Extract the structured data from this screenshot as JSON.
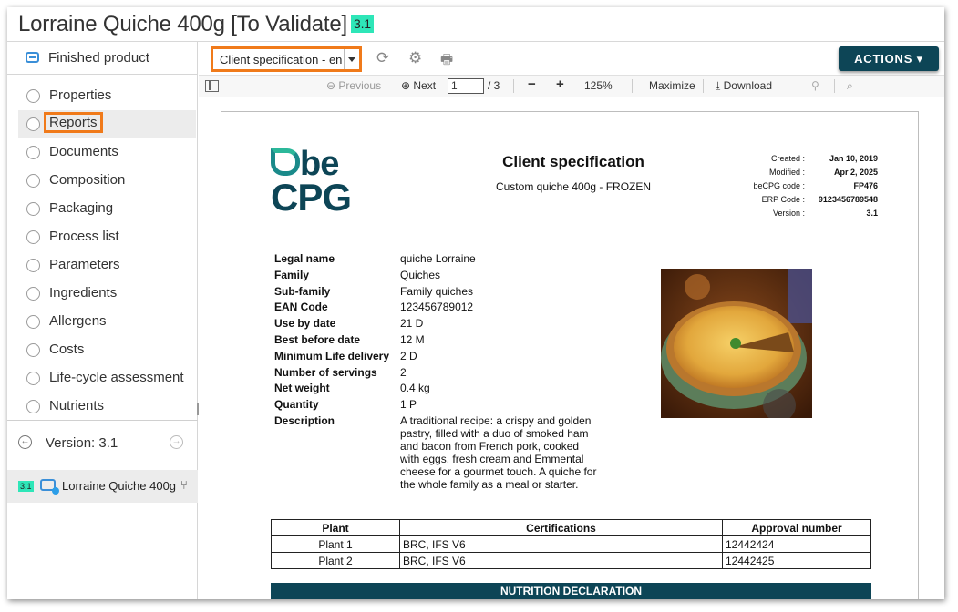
{
  "window": {
    "title": "Lorraine Quiche 400g [To Validate]",
    "version_badge": "3.1"
  },
  "sidebar": {
    "header": "Finished product",
    "items": [
      {
        "label": "Properties",
        "active": false
      },
      {
        "label": "Reports",
        "active": true
      },
      {
        "label": "Documents",
        "active": false
      },
      {
        "label": "Composition",
        "active": false
      },
      {
        "label": "Packaging",
        "active": false
      },
      {
        "label": "Process list",
        "active": false
      },
      {
        "label": "Parameters",
        "active": false
      },
      {
        "label": "Ingredients",
        "active": false
      },
      {
        "label": "Allergens",
        "active": false
      },
      {
        "label": "Costs",
        "active": false
      },
      {
        "label": "Life-cycle assessment",
        "active": false
      },
      {
        "label": "Nutrients",
        "active": false
      }
    ],
    "version_label": "Version: 3.1",
    "product": {
      "badge": "3.1",
      "name": "Lorraine Quiche 400g"
    }
  },
  "toolbar": {
    "report_select": "Client specification - en",
    "actions_label": "ACTIONS ▾"
  },
  "pdf_toolbar": {
    "previous": "Previous",
    "next": "Next",
    "page": "1",
    "page_total": "/ 3",
    "zoom": "125%",
    "maximize": "Maximize",
    "download": "Download"
  },
  "document": {
    "logo_top": "be",
    "logo_bottom": "CPG",
    "title": "Client specification",
    "subtitle": "Custom quiche 400g - FROZEN",
    "meta": [
      {
        "k": "Created :",
        "v": "Jan 10, 2019"
      },
      {
        "k": "Modified :",
        "v": "Apr 2, 2025"
      },
      {
        "k": "beCPG code :",
        "v": "FP476"
      },
      {
        "k": "ERP Code :",
        "v": "9123456789548"
      },
      {
        "k": "Version :",
        "v": "3.1"
      }
    ],
    "properties": [
      {
        "k": "Legal name",
        "v": "quiche Lorraine"
      },
      {
        "k": "Family",
        "v": "Quiches"
      },
      {
        "k": "Sub-family",
        "v": "Family quiches"
      },
      {
        "k": "EAN Code",
        "v": "123456789012"
      },
      {
        "k": "Use by date",
        "v": "21 D"
      },
      {
        "k": "Best before date",
        "v": "12 M"
      },
      {
        "k": "Minimum Life delivery",
        "v": "2 D"
      },
      {
        "k": "Number of servings",
        "v": "2"
      },
      {
        "k": "Net weight",
        "v": "0.4 kg"
      },
      {
        "k": "Quantity",
        "v": "1 P"
      },
      {
        "k": "Description",
        "v": "A traditional recipe: a crispy and golden pastry, filled with a duo of smoked ham and bacon from French pork, cooked with eggs, fresh cream and Emmental cheese for a gourmet touch. A quiche for the whole family as a meal or starter."
      }
    ],
    "plants_table": {
      "headers": [
        "Plant",
        "Certifications",
        "Approval number"
      ],
      "rows": [
        [
          "Plant 1",
          "BRC, IFS V6",
          "12442424"
        ],
        [
          "Plant 2",
          "BRC, IFS V6",
          "12442425"
        ]
      ]
    },
    "nutrition_heading": "NUTRITION DECLARATION"
  },
  "colors": {
    "accent": "#0d4556",
    "highlight": "#f07a1a",
    "badge": "#2ee6b8",
    "link_blue": "#3a8fd8"
  }
}
